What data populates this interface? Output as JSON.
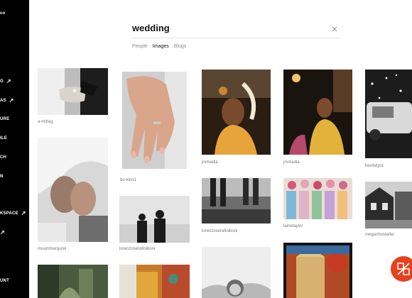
{
  "sidebar": {
    "logo": "co",
    "items": [
      {
        "label": "O",
        "arrow": "↗"
      },
      {
        "label": "AS",
        "arrow": "↗"
      },
      {
        "label": "URE",
        "arrow": ""
      },
      {
        "label": "ILE",
        "arrow": ""
      },
      {
        "label": "CH",
        "arrow": ""
      },
      {
        "label": "N",
        "arrow": ""
      },
      {
        "label": "KSPACE",
        "arrow": "↗"
      },
      {
        "label": "",
        "arrow": "↗"
      },
      {
        "label": "UNT",
        "arrow": ""
      }
    ]
  },
  "search": {
    "value": "wedding",
    "clear_icon": "close-icon"
  },
  "tabs": [
    {
      "label": "People",
      "active": false
    },
    {
      "label": "Images",
      "active": true
    },
    {
      "label": "Blogs",
      "active": false
    }
  ],
  "results": [
    {
      "user": "a-mittag"
    },
    {
      "user": "muammergurel"
    },
    {
      "user": ""
    },
    {
      "user": "bo-kino1"
    },
    {
      "user": "lorenzoserafiniboni"
    },
    {
      "user": ""
    },
    {
      "user": "jrxmedia"
    },
    {
      "user": "lorenzoserafiniboni"
    },
    {
      "user": ""
    },
    {
      "user": "jrxmedia"
    },
    {
      "user": "lainetaylor"
    },
    {
      "user": ""
    },
    {
      "user": "kevindyra"
    },
    {
      "user": "meganhostetler"
    }
  ],
  "badge": {
    "icon": "brand-logo-icon",
    "color": "#e7401c"
  }
}
